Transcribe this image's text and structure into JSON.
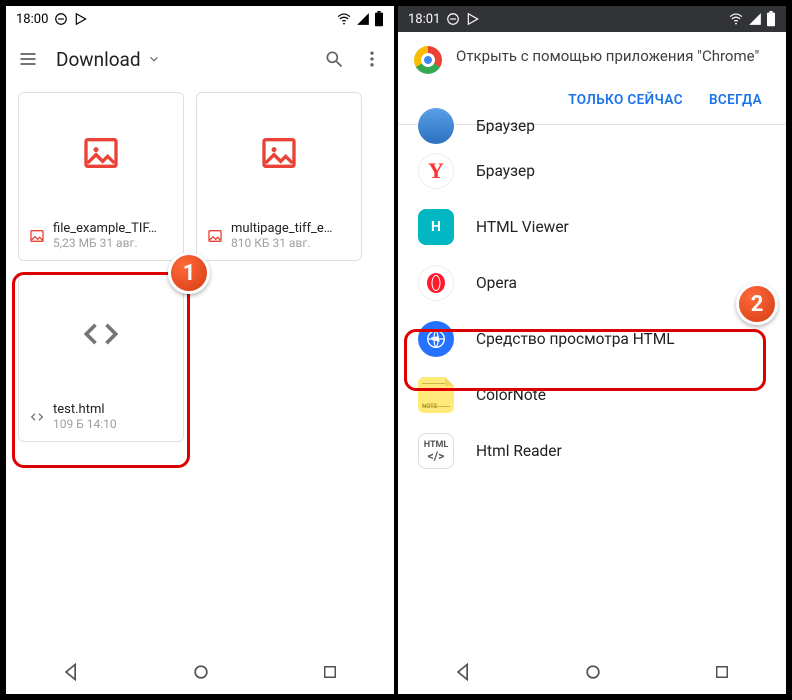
{
  "left": {
    "status_time": "18:00",
    "title": "Download",
    "files": [
      {
        "name": "file_example_TIF…",
        "sub": "5,23 МБ 31 авг."
      },
      {
        "name": "multipage_tiff_e…",
        "sub": "810 КБ 31 авг."
      },
      {
        "name": "test.html",
        "sub": "109 Б 14:10"
      }
    ],
    "badge": "1"
  },
  "right": {
    "status_time": "18:01",
    "sheet_title": "Открыть с помощью приложения \"Chrome\"",
    "action_once": "ТОЛЬКО СЕЙЧАС",
    "action_always": "ВСЕГДА",
    "apps": [
      {
        "name": "Браузер"
      },
      {
        "name": "Браузер"
      },
      {
        "name": "HTML Viewer"
      },
      {
        "name": "Opera"
      },
      {
        "name": "Средство просмотра HTML"
      },
      {
        "name": "ColorNote"
      },
      {
        "name": "Html Reader"
      }
    ],
    "badge": "2"
  }
}
